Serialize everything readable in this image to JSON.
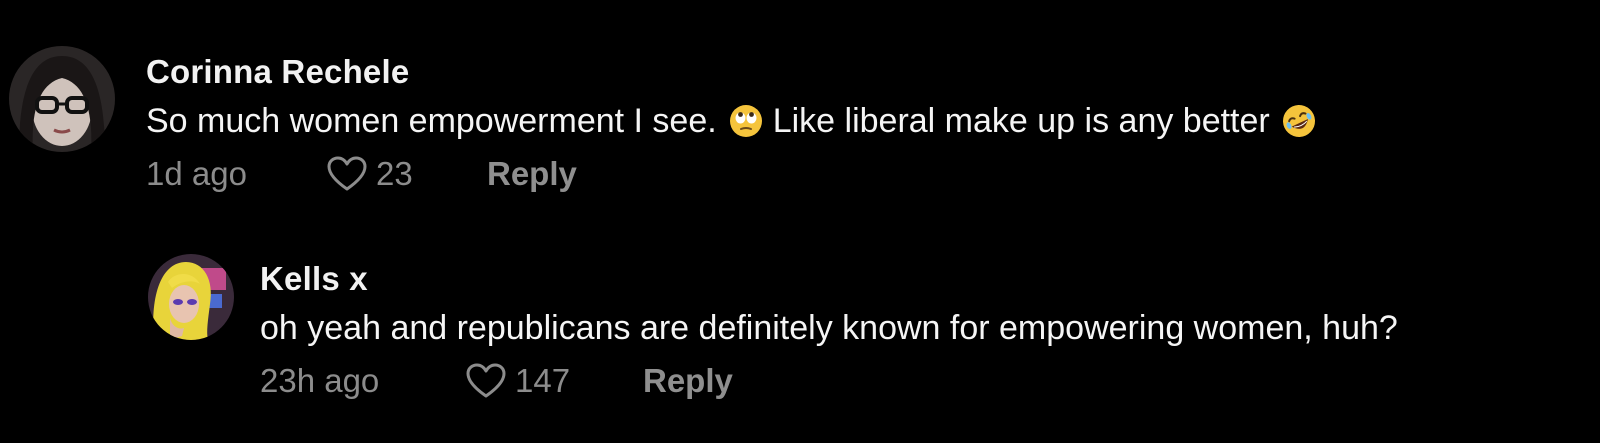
{
  "comments": [
    {
      "username": "Corinna Rechele",
      "text_part1": "So much women empowerment I see.",
      "emoji1": "eye-roll-emoji",
      "text_part2": "Like liberal make up is any better",
      "emoji2": "rolling-laughing-emoji",
      "timestamp": "1d ago",
      "likes": "23",
      "reply_label": "Reply"
    },
    {
      "username": "Kells x",
      "text": "oh yeah and republicans are definitely known for empowering women, huh?",
      "timestamp": "23h ago",
      "likes": "147",
      "reply_label": "Reply"
    }
  ],
  "colors": {
    "background": "#000000",
    "username": "#f2f2f2",
    "text": "#f5f5f5",
    "meta": "#8c8c8c"
  }
}
